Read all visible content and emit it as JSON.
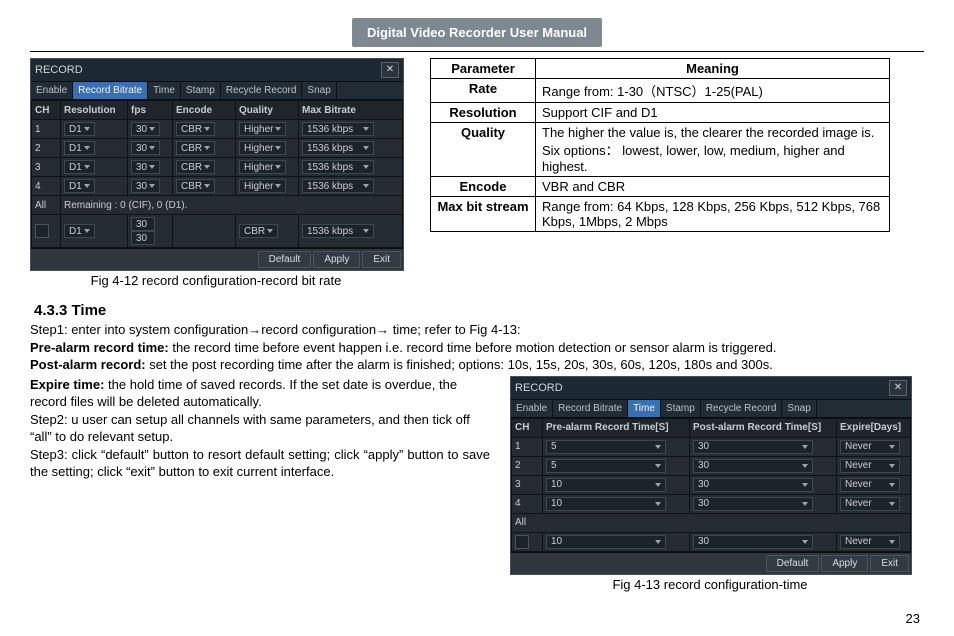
{
  "header": {
    "title": "Digital Video Recorder User Manual"
  },
  "fig12": {
    "record_title": "RECORD",
    "tabs": [
      "Enable",
      "Record Bitrate",
      "Time",
      "Stamp",
      "Recycle Record",
      "Snap"
    ],
    "active_tab_idx": 1,
    "cols": [
      "CH",
      "Resolution",
      "fps",
      "Encode",
      "Quality",
      "Max Bitrate"
    ],
    "rows": [
      {
        "ch": "1",
        "res": "D1",
        "fps": "30",
        "enc": "CBR",
        "q": "Higher",
        "br": "1536 kbps"
      },
      {
        "ch": "2",
        "res": "D1",
        "fps": "30",
        "enc": "CBR",
        "q": "Higher",
        "br": "1536 kbps"
      },
      {
        "ch": "3",
        "res": "D1",
        "fps": "30",
        "enc": "CBR",
        "q": "Higher",
        "br": "1536 kbps"
      },
      {
        "ch": "4",
        "res": "D1",
        "fps": "30",
        "enc": "CBR",
        "q": "Higher",
        "br": "1536 kbps"
      }
    ],
    "all_label": "All",
    "remaining": "Remaining : 0 (CIF), 0 (D1).",
    "all_row": {
      "res": "D1",
      "fps1": "30",
      "fps2": "30",
      "enc": "CBR",
      "br": "1536 kbps"
    },
    "buttons": [
      "Default",
      "Apply",
      "Exit"
    ],
    "caption": "Fig 4-12 record configuration-record bit rate"
  },
  "meaning": {
    "head": [
      "Parameter",
      "Meaning"
    ],
    "rows": [
      {
        "p": "Rate",
        "m": "Range from: 1-30（NTSC）1-25(PAL)"
      },
      {
        "p": "Resolution",
        "m": "Support CIF and D1"
      },
      {
        "p": "Quality",
        "m": "The higher the value is, the clearer the recorded image is. Six options： lowest, lower, low, medium, higher and highest."
      },
      {
        "p": "Encode",
        "m": "VBR and CBR"
      },
      {
        "p": "Max bit stream",
        "m": "Range from: 64 Kbps, 128 Kbps, 256 Kbps, 512 Kbps, 768 Kbps, 1Mbps, 2 Mbps"
      }
    ]
  },
  "section": {
    "heading": "4.3.3  Time",
    "step1": "Step1: enter into system configuration→record configuration→ time; refer to Fig 4-13:",
    "prealarm_label": "Pre-alarm record time: ",
    "prealarm_text": "the record time before event happen i.e. record time before motion detection or sensor alarm is triggered.",
    "postalarm_label": "Post-alarm record: ",
    "postalarm_text": "set the post recording time after the alarm is finished; options: 10s, 15s, 20s, 30s, 60s, 120s, 180s and 300s.",
    "expire_label": "Expire time: ",
    "expire_text": "the hold time of saved records. If the set date is overdue, the record files will be deleted automatically.",
    "step2": "Step2: u user can setup all channels with same parameters, and then tick off “all” to do relevant setup.",
    "step3": "Step3: click “default” button to resort default setting; click “apply” button to save the setting; click “exit” button to exit current interface."
  },
  "fig13": {
    "record_title": "RECORD",
    "tabs": [
      "Enable",
      "Record Bitrate",
      "Time",
      "Stamp",
      "Recycle Record",
      "Snap"
    ],
    "active_tab_idx": 2,
    "cols": [
      "CH",
      "Pre-alarm Record Time[S]",
      "Post-alarm Record Time[S]",
      "Expire[Days]"
    ],
    "rows": [
      {
        "ch": "1",
        "pre": "5",
        "post": "30",
        "exp": "Never"
      },
      {
        "ch": "2",
        "pre": "5",
        "post": "30",
        "exp": "Never"
      },
      {
        "ch": "3",
        "pre": "10",
        "post": "30",
        "exp": "Never"
      },
      {
        "ch": "4",
        "pre": "10",
        "post": "30",
        "exp": "Never"
      }
    ],
    "all_label": "All",
    "all_row": {
      "pre": "10",
      "post": "30",
      "exp": "Never"
    },
    "buttons": [
      "Default",
      "Apply",
      "Exit"
    ],
    "caption": "Fig 4-13 record configuration-time"
  },
  "page_number": "23"
}
